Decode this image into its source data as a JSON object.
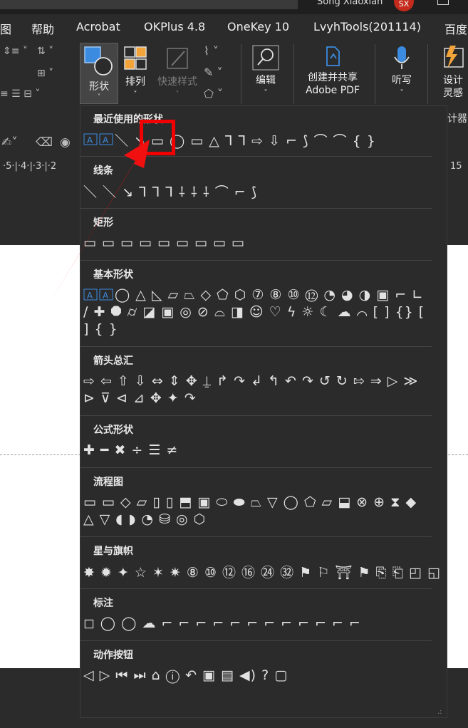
{
  "titlebar": {
    "user": "Song Xiaoxian",
    "avatar": "SX"
  },
  "menu": [
    "图",
    "帮助",
    "Acrobat",
    "OKPlus 4.8",
    "OneKey 10",
    "LvyhTools(201114)",
    "百度"
  ],
  "ribbon": {
    "shapes": "形状",
    "arrange": "排列",
    "quick_styles": "快速样式",
    "edit": "编辑",
    "create_share_1": "创建并共享",
    "create_share_2": "Adobe PDF",
    "dictate": "听写",
    "design_1": "设计",
    "design_2": "灵感",
    "designer_tail": "计器"
  },
  "ruler": {
    "left": "·5·|·4·|·3·|·2",
    "right": "15"
  },
  "sections": [
    {
      "title": "最近使用的形状",
      "rows": [
        " ＼ ↘ ▭ ◯ ▭ △ ⅂ ⅂ ⇨ ⇩ ⌐ ⟆ ⌒ ⌒ {  }"
      ]
    },
    {
      "title": "线条",
      "rows": [
        "＼ ＼ ↘ ⅂ ⅂ ⅂ ⸸ ⸸ ⸸ ⌒ ⌐ ⟆"
      ]
    },
    {
      "title": "矩形",
      "rows": [
        "▭ ▭ ▭ ▭ ▭ ▭ ▭ ▭ ▭"
      ]
    },
    {
      "title": "基本形状",
      "rows": [
        " ◯ △ ◺ ▱ ⏢ ◇ ⬠ ⬡ ⑦ ⑧ ⑩ ⑫ ◔ ◕ ◑ ▣ ⌐ ∟",
        "∕ ✚ ⯃ ⌭ ◪ ▣ ◎ ⊘ ⌓ ◨ ☺ ♡ ϟ ☼ ☾ ☁ ⌒ [ ] {} [",
        "] {  }"
      ]
    },
    {
      "title": "箭头总汇",
      "rows": [
        "⇨ ⇦ ⇧ ⇩ ⇔ ⇕ ✥ ⍊ ↱ ↷ ↲ ↰ ↶ ↷ ↺ ↻ ⇰ ⇒ ▷ ≫",
        "⊳ ⊽ ⊲ ⊿ ✥ ✦ ↷"
      ]
    },
    {
      "title": "公式形状",
      "rows": [
        "✚ ━ ✖ ÷ ☰ ≠"
      ]
    },
    {
      "title": "流程图",
      "rows": [
        "▭ ▭ ◇ ▱ ▯ ▯ ⬒ ▣ ⬭ ⬬ ⏢ ▽ ◯ ⬠ ▱ ⬓ ⊗ ⊕ ⧗ ◆",
        "△ ▽ ◖ ◗ ◔ ⛁ ◎ ⬡"
      ]
    },
    {
      "title": "星与旗帜",
      "rows": [
        "✸ ✹ ✦ ☆ ✶ ✷ ⑧ ⑩ ⑫ ⑯ ㉔ ㉜ ⚑ ⚐ ⛩ ⚑ ⎘ ⎗ ◰ ◱"
      ]
    },
    {
      "title": "标注",
      "rows": [
        "◻ ◯ ◯ ☁ ⌐ ⌐ ⌐ ⌐ ⌐ ⌐ ⌐ ⌐ ⌐ ⌐ ⌐ ⌐"
      ]
    },
    {
      "title": "动作按钮",
      "rows": [
        "◁ ▷ ⏮ ⏭ ⌂ ⓘ ↶ ▣ ▤ ◀) ? ▢"
      ]
    }
  ],
  "colors": {
    "highlight": "#f00000",
    "arrow": "#f01010",
    "accent": "#3b8be0"
  }
}
